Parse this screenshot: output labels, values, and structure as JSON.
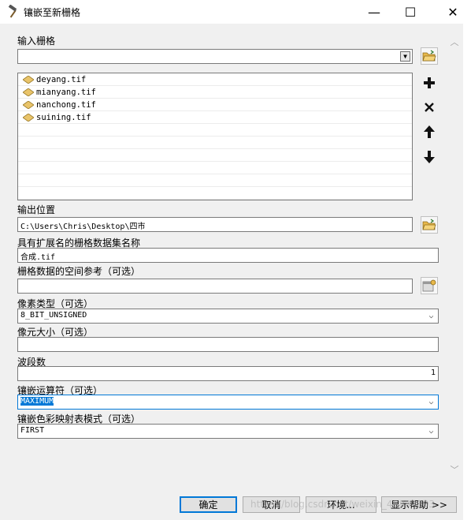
{
  "window": {
    "title": "镶嵌至新栅格",
    "minimize": "—",
    "maximize": "☐",
    "close": "✕"
  },
  "input_rasters": {
    "label": "输入栅格",
    "value": "",
    "items": [
      "deyang.tif",
      "mianyang.tif",
      "nanchong.tif",
      "suining.tif"
    ]
  },
  "output_location": {
    "label": "输出位置",
    "value": "C:\\Users\\Chris\\Desktop\\四市"
  },
  "dataset_name": {
    "label": "具有扩展名的栅格数据集名称",
    "value": "合成.tif"
  },
  "spatial_reference": {
    "label": "栅格数据的空间参考（可选）",
    "value": ""
  },
  "pixel_type": {
    "label": "像素类型（可选）",
    "value": "8_BIT_UNSIGNED"
  },
  "cell_size": {
    "label": "像元大小（可选）",
    "value": ""
  },
  "bands": {
    "label": "波段数",
    "value": "1"
  },
  "mosaic_operator": {
    "label": "镶嵌运算符（可选）",
    "value": "MAXIMUM"
  },
  "colormap_mode": {
    "label": "镶嵌色彩映射表模式（可选）",
    "value": "FIRST"
  },
  "buttons": {
    "ok": "确定",
    "cancel": "取消",
    "environments": "环境...",
    "show_help": "显示帮助 >>"
  },
  "watermark": "https://blog.csdn.net/weixin_45839803",
  "colors": {
    "accent": "#0078d7",
    "folder": "#e8b84a",
    "raster_icon": "#e9c46a"
  }
}
